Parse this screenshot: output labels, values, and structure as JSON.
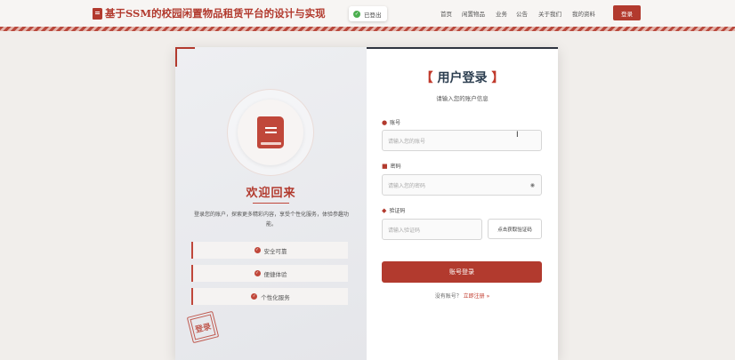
{
  "header": {
    "title": "基于SSM的校园闲置物品租赁平台的设计与实现",
    "toast": "已登出",
    "nav": [
      "首页",
      "闲置物品",
      "业务",
      "公告",
      "关于我们",
      "我的资料"
    ],
    "login_button": "登录"
  },
  "left": {
    "welcome": "欢迎回来",
    "description": "登录您的账户，探索更多精彩内容，享受个性化服务，体验参趣功能。",
    "features": [
      "安全可靠",
      "便捷体验",
      "个性化服务"
    ],
    "stamp": "登录"
  },
  "form": {
    "title_left": "【",
    "title": "用户登录",
    "title_right": "】",
    "subtitle": "请输入您的账户信息",
    "account_label": "账号",
    "account_placeholder": "请输入您的账号",
    "password_label": "密码",
    "password_placeholder": "请输入您的密码",
    "captcha_label": "验证码",
    "captcha_placeholder": "请输入验证码",
    "captcha_button": "点击获取验证码",
    "submit": "账号登录",
    "register_prompt": "没有账号？",
    "register_link": "立即注册 »"
  },
  "colors": {
    "accent": "#b23a2e",
    "background": "#f1eeeb",
    "dark_title": "#2c3e50"
  },
  "icons": [
    "book-icon",
    "user-icon",
    "lock-icon",
    "shield-icon",
    "eye-icon",
    "check-icon",
    "check-circle-icon",
    "text-cursor-icon"
  ]
}
